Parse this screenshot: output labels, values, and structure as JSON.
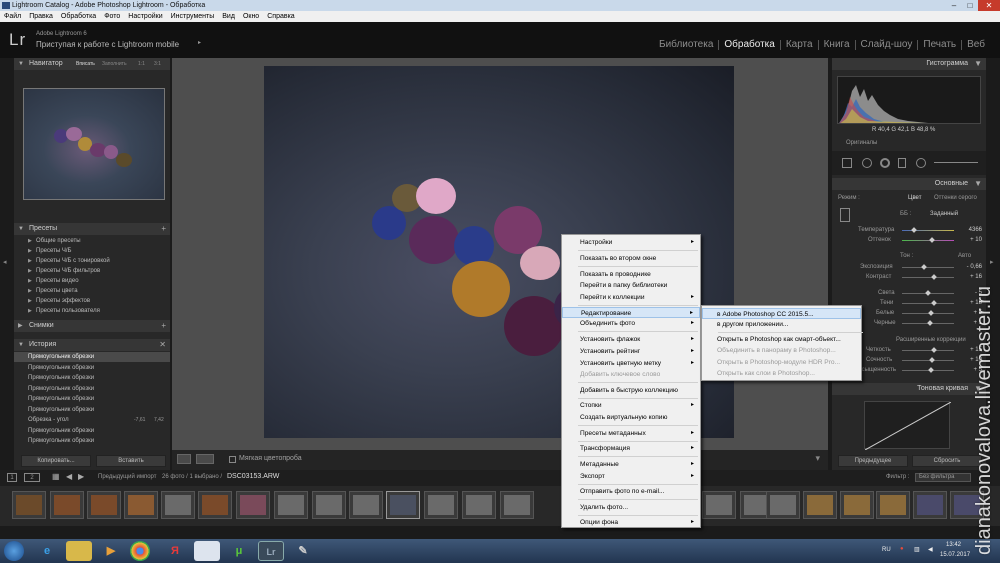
{
  "window": {
    "title": "Lightroom Catalog - Adobe Photoshop Lightroom - Обработка",
    "controls": [
      "–",
      "□",
      "✕"
    ]
  },
  "menubar": [
    "Файл",
    "Правка",
    "Обработка",
    "Фото",
    "Настройки",
    "Инструменты",
    "Вид",
    "Окно",
    "Справка"
  ],
  "identity": {
    "logo": "Lr",
    "product": "Adobe Lightroom 6",
    "mobile": "Приступая к работе с Lightroom mobile",
    "arrow": "▸"
  },
  "modules": [
    {
      "label": "Библиотека",
      "active": false
    },
    {
      "label": "Обработка",
      "active": true
    },
    {
      "label": "Карта",
      "active": false
    },
    {
      "label": "Книга",
      "active": false
    },
    {
      "label": "Слайд-шоу",
      "active": false
    },
    {
      "label": "Печать",
      "active": false
    },
    {
      "label": "Веб",
      "active": false
    }
  ],
  "left_panel": {
    "navigator": {
      "title": "Навигатор",
      "options": [
        "Вписать",
        "Заполнить",
        "1:1",
        "3:1"
      ]
    },
    "presets": {
      "title": "Пресеты",
      "items": [
        "Общие пресеты",
        "Пресеты Ч/Б",
        "Пресеты Ч/Б с тонировкой",
        "Пресеты Ч/Б фильтров",
        "Пресеты видео",
        "Пресеты цвета",
        "Пресеты эффектов",
        "Пресеты пользователя"
      ]
    },
    "snapshots": {
      "title": "Снимки"
    },
    "history": {
      "title": "История",
      "close": "✕",
      "items": [
        {
          "label": "Прямоугольник обрезки",
          "v1": "",
          "v2": "",
          "selected": true
        },
        {
          "label": "Прямоугольник обрезки",
          "v1": "",
          "v2": "",
          "selected": false
        },
        {
          "label": "Прямоугольник обрезки",
          "v1": "",
          "v2": "",
          "selected": false
        },
        {
          "label": "Прямоугольник обрезки",
          "v1": "",
          "v2": "",
          "selected": false
        },
        {
          "label": "Прямоугольник обрезки",
          "v1": "",
          "v2": "",
          "selected": false
        },
        {
          "label": "Прямоугольник обрезки",
          "v1": "",
          "v2": "",
          "selected": false
        },
        {
          "label": "Обрезка - угол",
          "v1": "-7,61",
          "v2": "7,42",
          "selected": false
        },
        {
          "label": "Прямоугольник обрезки",
          "v1": "",
          "v2": "",
          "selected": false
        },
        {
          "label": "Прямоугольник обрезки",
          "v1": "",
          "v2": "",
          "selected": false
        }
      ]
    },
    "copy_button": "Копировать...",
    "paste_button": "Вставить"
  },
  "toolbar": {
    "soft_proof": "Мягкая цветопроба"
  },
  "right_panel": {
    "histogram_title": "Гистограмма",
    "rgb": "R 40,4  G 42,1  B 48,8 %",
    "original_photo": "Оригиналы",
    "basic_title": "Основные",
    "treatment_label": "Режим :",
    "treatment_color": "Цвет",
    "treatment_bw": "Оттенки серого",
    "wb_label": "ББ :",
    "wb_value": "Заданный",
    "temp": {
      "label": "Температура",
      "value": "4366"
    },
    "tint": {
      "label": "Оттенок",
      "value": "+ 10"
    },
    "tone_label": "Тон :",
    "tone_auto": "Авто",
    "exposure": {
      "label": "Экспозиция",
      "value": "- 0,66"
    },
    "contrast": {
      "label": "Контраст",
      "value": "+ 16"
    },
    "highlights": {
      "label": "Света",
      "value": "- 5"
    },
    "shadows": {
      "label": "Тени",
      "value": "+ 18"
    },
    "whites": {
      "label": "Белые",
      "value": "+ 5"
    },
    "blacks": {
      "label": "Черные",
      "value": "+ 1"
    },
    "presence_label": "Расширенные коррекции",
    "clarity": {
      "label": "Четкость",
      "value": "+ 15"
    },
    "vibrance": {
      "label": "Сочность",
      "value": "+ 10"
    },
    "saturation": {
      "label": "Насыщенность",
      "value": "+ 5"
    },
    "tone_curve_title": "Тоновая кривая",
    "previous_button": "Предыдущее",
    "reset_button": "Сбросить"
  },
  "filmstrip": {
    "pages": [
      "1",
      "2"
    ],
    "source": "Предыдущий импорт",
    "count": "26 фото / 1 выбрано /",
    "file": "DSC03153.ARW",
    "filter_label": "Фильтр :",
    "filter_value": "Без фильтра"
  },
  "context_menu": {
    "items": [
      {
        "label": "Настройки",
        "arrow": "▸",
        "disabled": false,
        "highlighted": false
      },
      {
        "label": "Показать во втором окне",
        "arrow": "",
        "disabled": false,
        "highlighted": false
      },
      {
        "label": "Показать в проводнике",
        "arrow": "",
        "disabled": false,
        "highlighted": false
      },
      {
        "label": "Перейти в папку библиотеки",
        "arrow": "",
        "disabled": false,
        "highlighted": false
      },
      {
        "label": "Перейти к коллекции",
        "arrow": "▸",
        "disabled": false,
        "highlighted": false
      },
      {
        "label": "Редактирование",
        "arrow": "▸",
        "disabled": false,
        "highlighted": true
      },
      {
        "label": "Объединить фото",
        "arrow": "▸",
        "disabled": false,
        "highlighted": false
      },
      {
        "label": "Установить флажок",
        "arrow": "▸",
        "disabled": false,
        "highlighted": false
      },
      {
        "label": "Установить рейтинг",
        "arrow": "▸",
        "disabled": false,
        "highlighted": false
      },
      {
        "label": "Установить цветную метку",
        "arrow": "▸",
        "disabled": false,
        "highlighted": false
      },
      {
        "label": "Добавить ключевое слово",
        "arrow": "",
        "disabled": true,
        "highlighted": false
      },
      {
        "label": "Добавить в быструю коллекцию",
        "arrow": "",
        "disabled": false,
        "highlighted": false
      },
      {
        "label": "Стопки",
        "arrow": "▸",
        "disabled": false,
        "highlighted": false
      },
      {
        "label": "Создать виртуальную копию",
        "arrow": "",
        "disabled": false,
        "highlighted": false
      },
      {
        "label": "Пресеты метаданных",
        "arrow": "▸",
        "disabled": false,
        "highlighted": false
      },
      {
        "label": "Трансформация",
        "arrow": "▸",
        "disabled": false,
        "highlighted": false
      },
      {
        "label": "Метаданные",
        "arrow": "▸",
        "disabled": false,
        "highlighted": false
      },
      {
        "label": "Экспорт",
        "arrow": "▸",
        "disabled": false,
        "highlighted": false
      },
      {
        "label": "Отправить фото по e-mail...",
        "arrow": "",
        "disabled": false,
        "highlighted": false
      },
      {
        "label": "Удалить фото...",
        "arrow": "",
        "disabled": false,
        "highlighted": false
      },
      {
        "label": "Опции фона",
        "arrow": "▸",
        "disabled": false,
        "highlighted": false
      }
    ]
  },
  "submenu": {
    "items": [
      {
        "label": "в Adobe Photoshop CC 2015.5...",
        "disabled": false,
        "highlighted": true
      },
      {
        "label": "в другом приложении...",
        "disabled": false,
        "highlighted": false
      },
      {
        "label": "Открыть в Photoshop как смарт-объект...",
        "disabled": false,
        "highlighted": false
      },
      {
        "label": "Объединить в панораму в Photoshop...",
        "disabled": true,
        "highlighted": false
      },
      {
        "label": "Открыть в Photoshop-модуле HDR Pro...",
        "disabled": true,
        "highlighted": false
      },
      {
        "label": "Открыть как слои в Photoshop...",
        "disabled": true,
        "highlighted": false
      }
    ]
  },
  "taskbar": {
    "lang": "RU",
    "time": "13:42",
    "date": "15.07.2017"
  },
  "watermark": "dianakonovalova.livemaster.ru"
}
